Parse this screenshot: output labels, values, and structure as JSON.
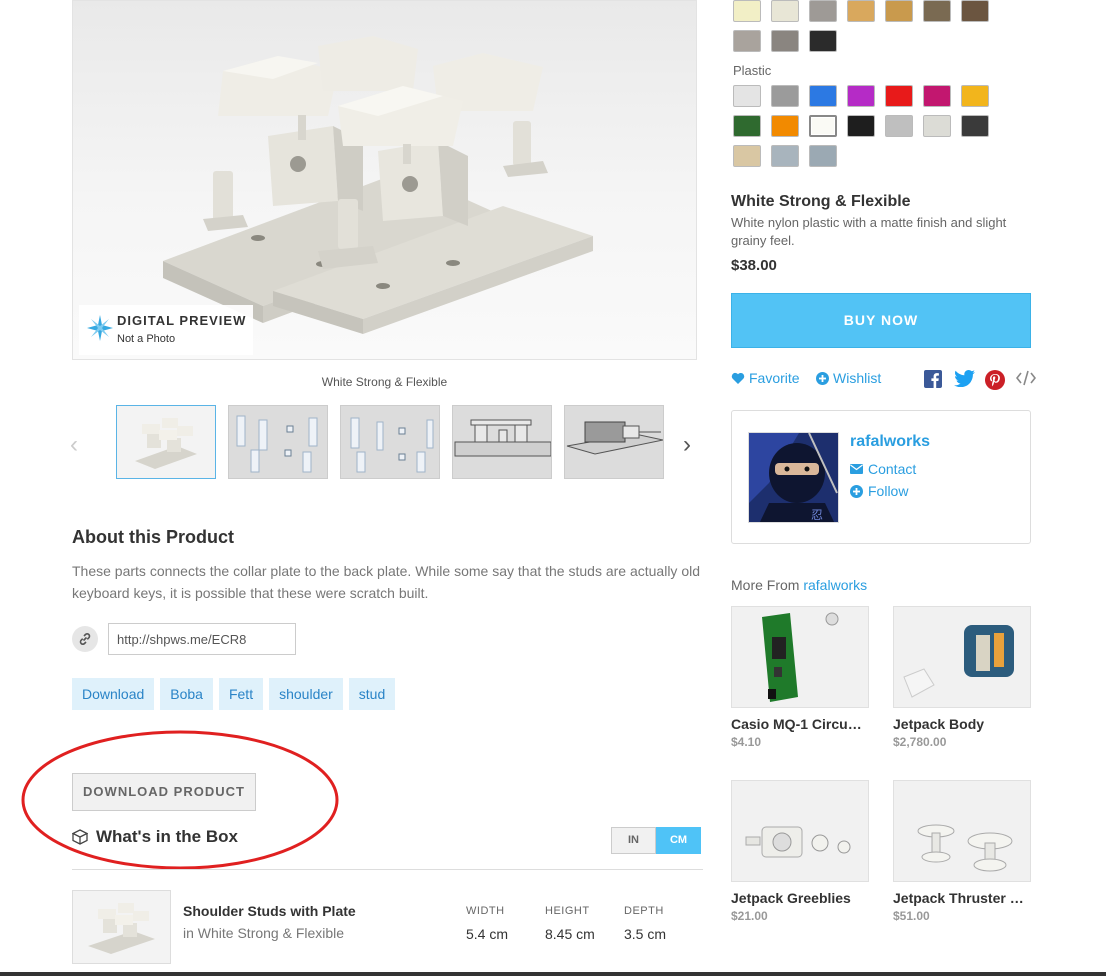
{
  "preview": {
    "badge_title": "DIGITAL PREVIEW",
    "badge_sub": "Not a Photo",
    "caption": "White Strong & Flexible"
  },
  "thumbnails": {
    "prev_glyph": "‹",
    "next_glyph": "›",
    "count": 5,
    "active_index": 0
  },
  "about": {
    "title": "About this Product",
    "text": "These parts connects the collar plate to the back plate. While some say that the studs are actually old keyboard keys, it is possible that these were scratch built.",
    "short_link": "http://shpws.me/ECR8"
  },
  "tags": [
    "Download",
    "Boba",
    "Fett",
    "shoulder",
    "stud"
  ],
  "download_button": "DOWNLOAD PRODUCT",
  "box": {
    "title": "What's in the Box",
    "units": [
      "IN",
      "CM"
    ],
    "selected_unit": "CM",
    "item_name": "Shoulder Studs with Plate",
    "item_material": "in White Strong & Flexible",
    "dims": [
      {
        "label": "WIDTH",
        "value": "5.4 cm"
      },
      {
        "label": "HEIGHT",
        "value": "8.45 cm"
      },
      {
        "label": "DEPTH",
        "value": "3.5 cm"
      }
    ]
  },
  "materials": {
    "top_swatches": [
      "#f2efc6",
      "#e8e6d6",
      "#9e9a96",
      "#d9a85d",
      "#c99a4d",
      "#7a6a52",
      "#6b5540"
    ],
    "top_swatches_row2": [
      "#a9a39d",
      "#8a8580",
      "#2b2b2b"
    ],
    "plastic_label": "Plastic",
    "plastic_row1": [
      "#e4e4e4",
      "#9b9b9b",
      "#2c79e3",
      "#b52bc6",
      "#e81a1a",
      "#c2176f",
      "#f2b51c"
    ],
    "plastic_row2": [
      "#2f6a2f",
      "#f28a00",
      "#fafaf5",
      "#1e1e1e",
      "#bfbfbf",
      "#dcdcd6",
      "#3a3a3a"
    ],
    "plastic_row3": [
      "#d9c7a3",
      "#a8b4bd",
      "#9ba9b3"
    ],
    "selected": "White Strong & Flexible",
    "description": "White nylon plastic with a matte finish and slight grainy feel.",
    "price": "$38.00",
    "buy_label": "BUY NOW"
  },
  "social": {
    "favorite": "Favorite",
    "wishlist": "Wishlist"
  },
  "seller": {
    "name": "rafalworks",
    "contact": "Contact",
    "follow": "Follow"
  },
  "more_from": {
    "prefix": "More From",
    "shop": "rafalworks",
    "items": [
      {
        "name": "Casio MQ-1 Circu…",
        "price": "$4.10"
      },
      {
        "name": "Jetpack Body",
        "price": "$2,780.00"
      },
      {
        "name": "Jetpack Greeblies",
        "price": "$21.00"
      },
      {
        "name": "Jetpack Thruster …",
        "price": "$51.00"
      }
    ]
  },
  "colors": {
    "accent": "#52c3f5",
    "link": "#2a9ee0",
    "annotation": "#e02020"
  }
}
